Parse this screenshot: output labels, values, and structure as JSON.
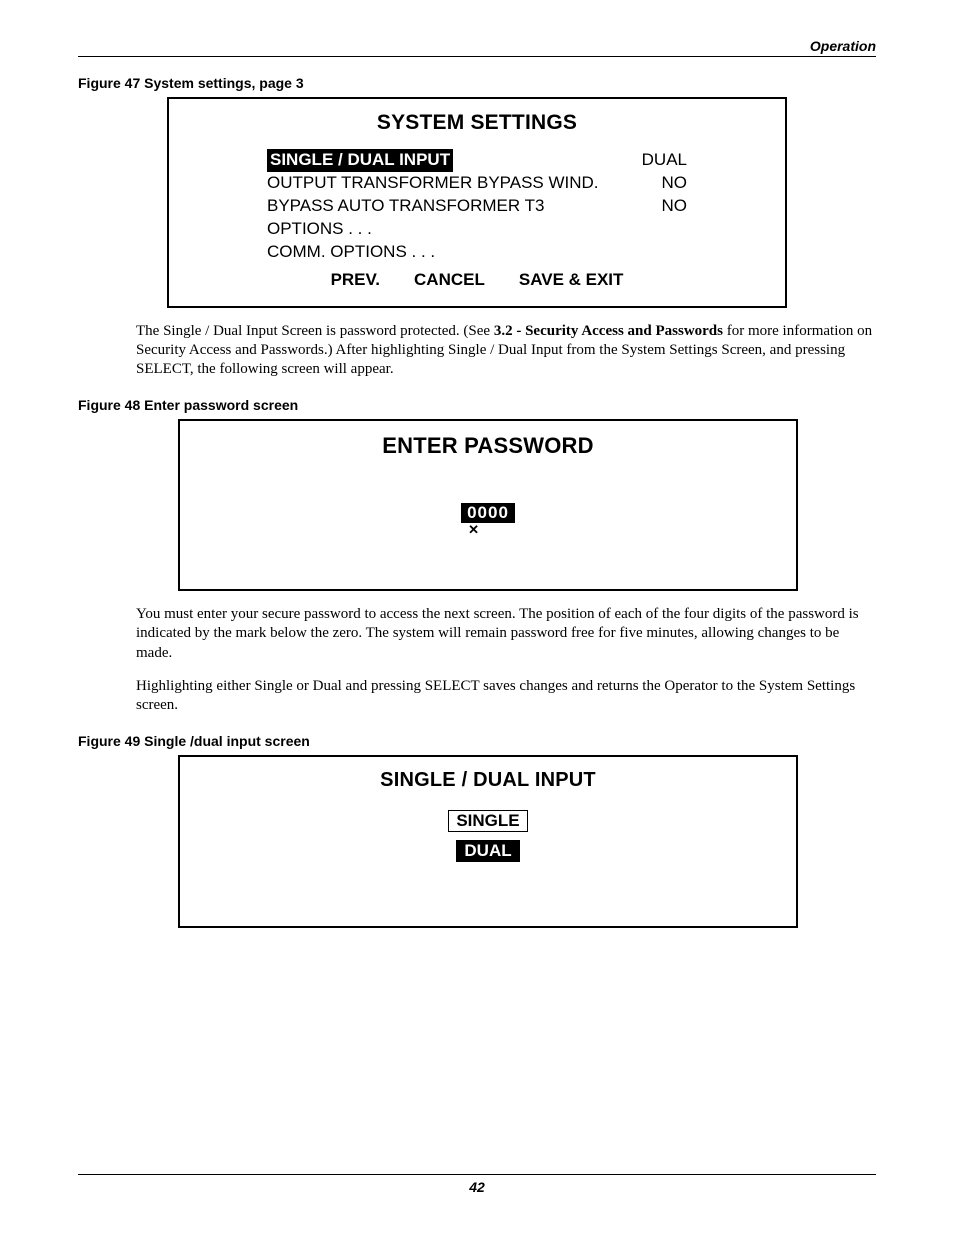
{
  "header": {
    "section": "Operation"
  },
  "page_number": "42",
  "fig47": {
    "caption": "Figure 47  System settings, page 3",
    "title": "SYSTEM SETTINGS",
    "rows": [
      {
        "label": "SINGLE / DUAL INPUT",
        "value": "DUAL",
        "highlighted": true
      },
      {
        "label": "OUTPUT TRANSFORMER BYPASS WIND.",
        "value": "NO"
      },
      {
        "label": "BYPASS AUTO TRANSFORMER   T3",
        "value": "NO"
      },
      {
        "label": "OPTIONS . . .",
        "value": ""
      },
      {
        "label": "COMM. OPTIONS . . .",
        "value": ""
      }
    ],
    "nav": {
      "prev": "PREV.",
      "cancel": "CANCEL",
      "save": "SAVE & EXIT"
    }
  },
  "para1": {
    "pre": "The Single / Dual Input Screen is password protected. (See ",
    "bold": "3.2 - Security Access and Passwords",
    "post": " for more information on Security Access and Passwords.) After highlighting Single / Dual Input from the System Settings Screen, and pressing SELECT, the following screen will appear."
  },
  "fig48": {
    "caption": "Figure 48  Enter password screen",
    "title": "ENTER PASSWORD",
    "digits": "0000"
  },
  "para2": "You must enter your secure password to access the next screen. The position of each of the four digits of the password is indicated by the mark below the zero. The system will remain password free for five minutes, allowing changes to be made.",
  "para3": "Highlighting either Single or Dual and pressing SELECT saves changes and returns the Operator to the System Settings screen.",
  "fig49": {
    "caption": "Figure 49  Single /dual input screen",
    "title": "SINGLE / DUAL INPUT",
    "option1": "SINGLE",
    "option2": "DUAL"
  }
}
